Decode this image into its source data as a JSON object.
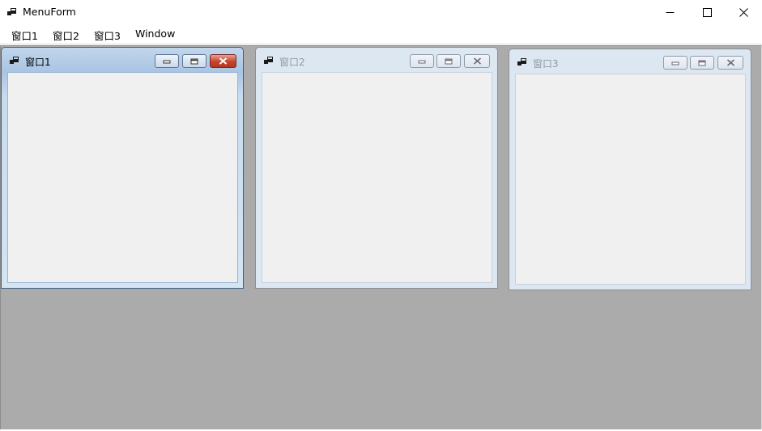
{
  "window": {
    "title": "MenuForm",
    "icon": "mdi-app-icon",
    "minimize_icon": "minimize-icon",
    "maximize_icon": "maximize-icon",
    "close_icon": "close-icon"
  },
  "menu": {
    "items": [
      {
        "label": "窗口1"
      },
      {
        "label": "窗口2"
      },
      {
        "label": "窗口3"
      },
      {
        "label": "Window"
      }
    ]
  },
  "mdi_children": [
    {
      "title": "窗口1",
      "state": "active"
    },
    {
      "title": "窗口2",
      "state": "inactive"
    },
    {
      "title": "窗口3",
      "state": "inactive"
    }
  ],
  "colors": {
    "mdi_background": "#ababab",
    "active_caption": "#a9c4e4",
    "inactive_caption": "#dde7f2",
    "close_button_active": "#c7432d"
  }
}
